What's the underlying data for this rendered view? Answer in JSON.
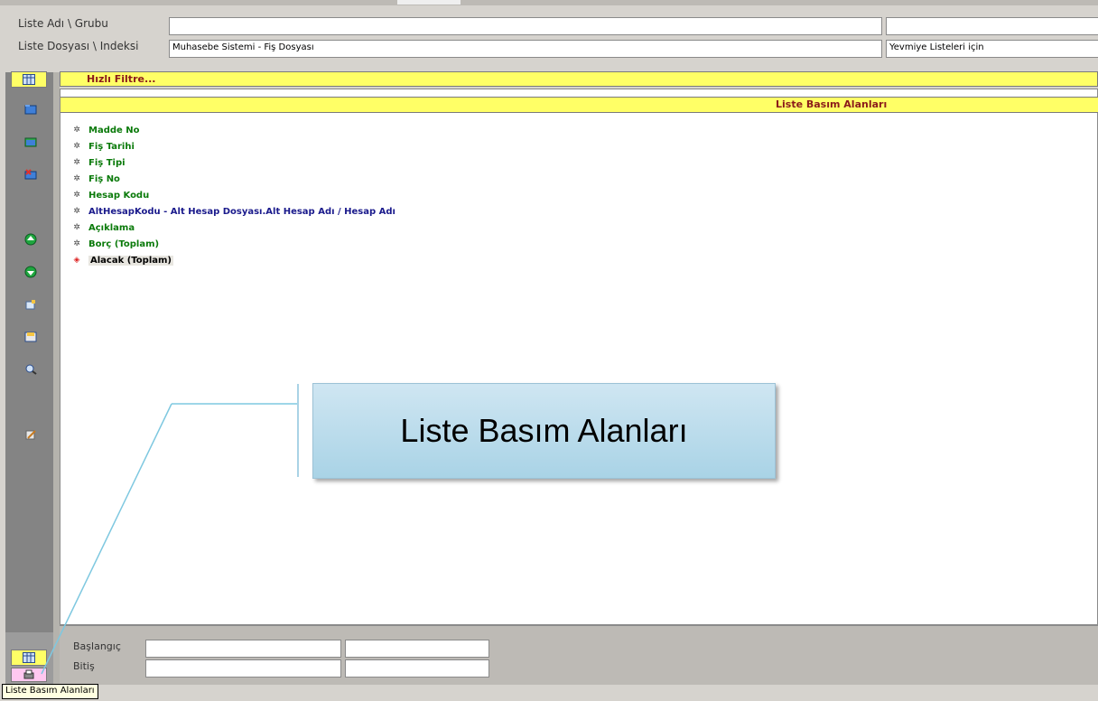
{
  "header": {
    "name_label": "Liste Adı \\ Grubu",
    "name_value": "",
    "name_value_right": "",
    "file_label": "Liste Dosyası \\ Indeksi",
    "file_value": "Muhasebe Sistemi - Fiş Dosyası",
    "file_value_right": "Yevmiye Listeleri için"
  },
  "quick_filter": {
    "label": "Hızlı Filtre..."
  },
  "panel": {
    "title": "Liste Basım Alanları",
    "items": [
      {
        "label": "Madde No",
        "color": "#0a7a0a"
      },
      {
        "label": "Fiş Tarihi",
        "color": "#0a7a0a"
      },
      {
        "label": "Fiş Tipi",
        "color": "#0a7a0a"
      },
      {
        "label": "Fiş No",
        "color": "#0a7a0a"
      },
      {
        "label": "Hesap Kodu",
        "color": "#0a7a0a"
      },
      {
        "label": "AltHesapKodu - Alt Hesap Dosyası.Alt Hesap Adı / Hesap Adı",
        "color": "#1a1a8c"
      },
      {
        "label": "Açıklama",
        "color": "#0a7a0a"
      },
      {
        "label": "Borç  (Toplam)",
        "color": "#0a7a0a"
      },
      {
        "label": "Alacak  (Toplam)",
        "color": "#000000",
        "selected": true
      }
    ]
  },
  "footer": {
    "start_label": "Başlangıç",
    "start_value": "",
    "start_value_2": "",
    "end_label": "Bitiş",
    "end_value": "",
    "end_value_2": ""
  },
  "callout": {
    "text": "Liste Basım Alanları"
  },
  "tooltip": {
    "text": "Liste Basım Alanları"
  },
  "icons": [
    "grid-icon",
    "folder-open-icon",
    "folder-new-icon",
    "delete-icon",
    "arrow-up-icon",
    "arrow-down-icon",
    "edit-icon",
    "save-icon",
    "search-icon",
    "pencil-icon",
    "grid-icon-bottom",
    "print-icon"
  ]
}
